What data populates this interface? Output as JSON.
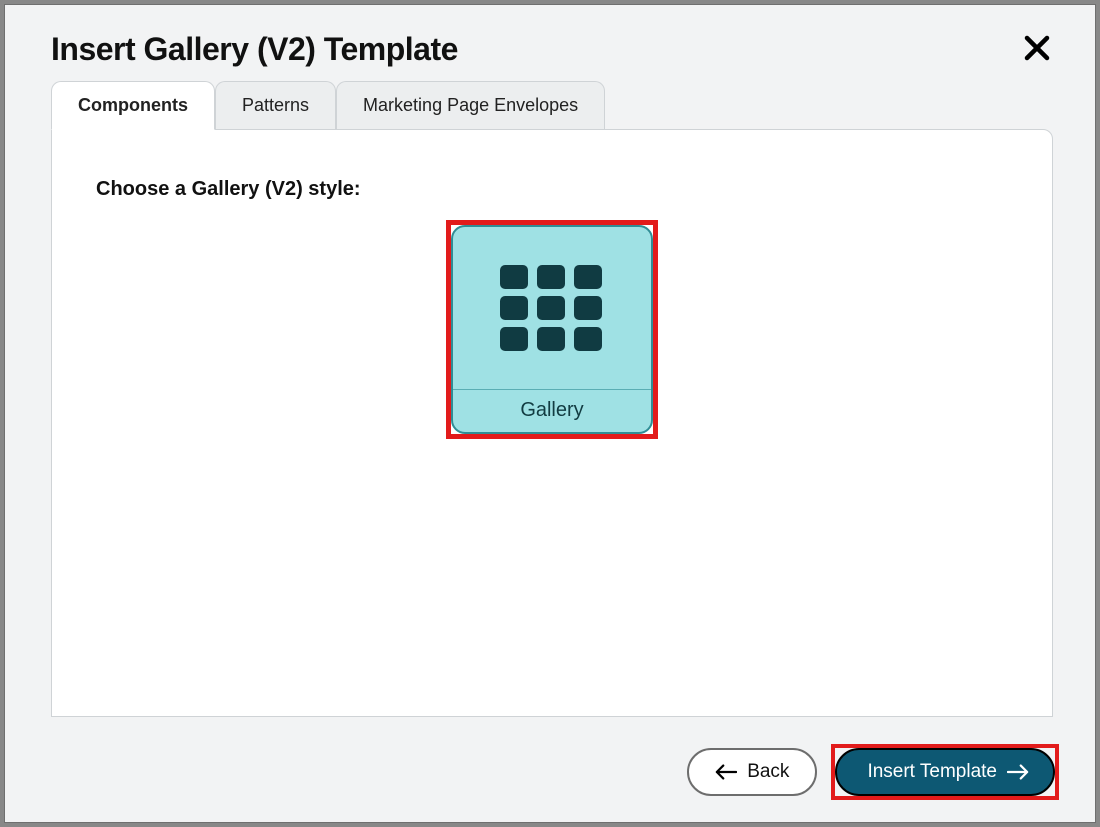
{
  "dialog": {
    "title": "Insert Gallery (V2) Template"
  },
  "tabs": {
    "components": "Components",
    "patterns": "Patterns",
    "envelopes": "Marketing Page Envelopes",
    "active": "components"
  },
  "body": {
    "prompt": "Choose a Gallery (V2) style:",
    "tile_label": "Gallery"
  },
  "footer": {
    "back_label": "Back",
    "insert_label": "Insert Template"
  },
  "colors": {
    "highlight": "#e21b1b",
    "tile_bg": "#9fe1e4",
    "tile_border": "#2f8d95",
    "icon_square": "#103b42",
    "primary_btn": "#0d5873"
  }
}
